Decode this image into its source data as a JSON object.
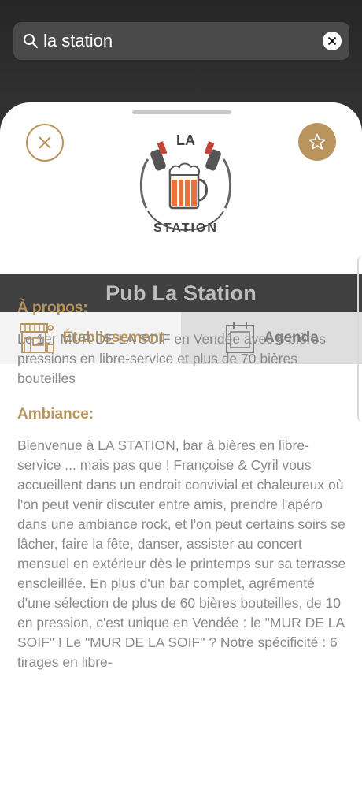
{
  "search": {
    "value": "la station",
    "icon": "search-icon",
    "clear_icon": "close-circle-icon"
  },
  "sheet": {
    "close_icon": "close-icon",
    "favorite_icon": "star-icon",
    "logo": {
      "text_top": "LA",
      "text_bottom": "STATION"
    },
    "title": "Pub La Station",
    "tabs": [
      {
        "label": "Établissement",
        "icon": "storefront-icon",
        "active": true
      },
      {
        "label": "Agenda",
        "icon": "calendar-icon",
        "active": false
      }
    ]
  },
  "about": {
    "title": "À propos:",
    "text": "Le 1er MUR DE LA SOIF en Vendée avec 6 bières pressions en libre-service et plus de 70 bières bouteilles"
  },
  "ambiance": {
    "title": "Ambiance:",
    "text": "Bienvenue à LA STATION, bar à bières en libre-service ... mais pas que ! Françoise & Cyril vous accueillent dans un endroit convivial et chaleureux où l'on peut venir discuter entre amis, prendre l'apéro dans une ambiance rock, et l'on peut certains soirs se lâcher, faire la fête, danser, assister au concert mensuel en extérieur dès le printemps sur sa terrasse ensoleillée. En plus d'un bar complet, agrémenté d'une sélection de plus de 60 bières bouteilles, de 10 en pression, c'est unique en Vendée : le \"MUR DE LA SOIF\" ! Le \"MUR DE LA SOIF\" ? Notre spécificité : 6 tirages en libre-"
  },
  "colors": {
    "accent": "#b9955d",
    "title_bar": "#404040",
    "body_text": "#8a8a8a"
  }
}
